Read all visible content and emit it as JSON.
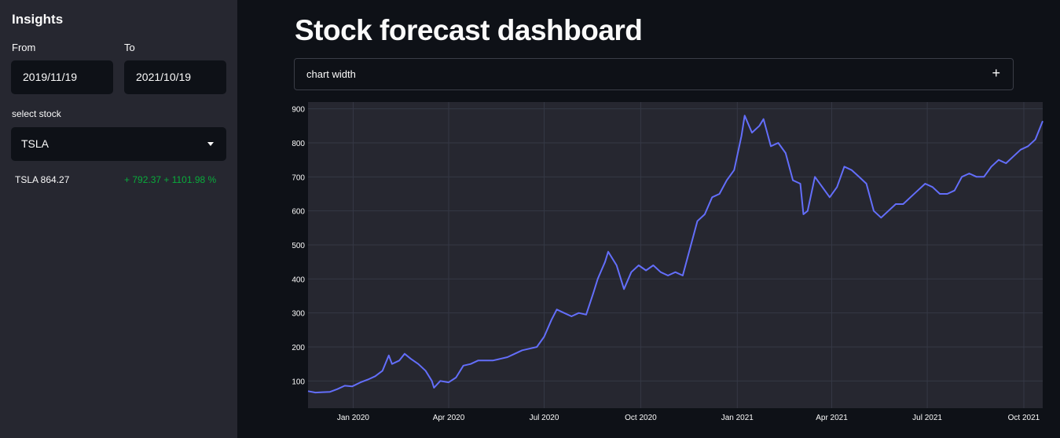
{
  "sidebar": {
    "title": "Insights",
    "from_label": "From",
    "to_label": "To",
    "from_value": "2019/11/19",
    "to_value": "2021/10/19",
    "select_label": "select stock",
    "selected_stock": "TSLA",
    "metric_value": "TSLA 864.27",
    "metric_delta": "+ 792.37 + 1101.98 %",
    "delta_color": "#09ab3b"
  },
  "main": {
    "title": "Stock forecast dashboard",
    "expander_label": "chart width",
    "expander_icon": "plus-icon"
  },
  "chart_data": {
    "type": "line",
    "title": "",
    "xlabel": "",
    "ylabel": "",
    "ylim": [
      20,
      920
    ],
    "xlim": [
      "2019-11-19",
      "2021-10-19"
    ],
    "yticks": [
      100,
      200,
      300,
      400,
      500,
      600,
      700,
      800,
      900
    ],
    "xticks": [
      "2020-01-01",
      "2020-04-01",
      "2020-07-01",
      "2020-10-01",
      "2021-01-01",
      "2021-04-01",
      "2021-07-01",
      "2021-10-01"
    ],
    "xtick_labels": [
      "Jan 2020",
      "Apr 2020",
      "Jul 2020",
      "Oct 2020",
      "Jan 2021",
      "Apr 2021",
      "Jul 2021",
      "Oct 2021"
    ],
    "grid": true,
    "line_color": "#636efa",
    "series": [
      {
        "x": [
          "2019-11-19",
          "2019-11-26",
          "2019-12-03",
          "2019-12-10",
          "2019-12-17",
          "2019-12-24",
          "2019-12-31",
          "2020-01-08",
          "2020-01-15",
          "2020-01-22",
          "2020-01-29",
          "2020-02-04",
          "2020-02-07",
          "2020-02-14",
          "2020-02-19",
          "2020-02-25",
          "2020-03-03",
          "2020-03-10",
          "2020-03-16",
          "2020-03-18",
          "2020-03-24",
          "2020-04-01",
          "2020-04-08",
          "2020-04-15",
          "2020-04-22",
          "2020-04-29",
          "2020-05-06",
          "2020-05-13",
          "2020-05-20",
          "2020-05-27",
          "2020-06-03",
          "2020-06-10",
          "2020-06-17",
          "2020-06-24",
          "2020-07-01",
          "2020-07-08",
          "2020-07-13",
          "2020-07-20",
          "2020-07-27",
          "2020-08-03",
          "2020-08-10",
          "2020-08-17",
          "2020-08-21",
          "2020-08-28",
          "2020-08-31",
          "2020-09-08",
          "2020-09-15",
          "2020-09-22",
          "2020-09-29",
          "2020-10-06",
          "2020-10-13",
          "2020-10-20",
          "2020-10-27",
          "2020-11-03",
          "2020-11-10",
          "2020-11-17",
          "2020-11-24",
          "2020-12-01",
          "2020-12-08",
          "2020-12-15",
          "2020-12-22",
          "2020-12-29",
          "2021-01-05",
          "2021-01-08",
          "2021-01-15",
          "2021-01-22",
          "2021-01-26",
          "2021-02-02",
          "2021-02-09",
          "2021-02-16",
          "2021-02-23",
          "2021-03-02",
          "2021-03-05",
          "2021-03-09",
          "2021-03-16",
          "2021-03-23",
          "2021-03-30",
          "2021-04-06",
          "2021-04-13",
          "2021-04-20",
          "2021-04-27",
          "2021-05-04",
          "2021-05-11",
          "2021-05-18",
          "2021-05-25",
          "2021-06-01",
          "2021-06-08",
          "2021-06-15",
          "2021-06-22",
          "2021-06-29",
          "2021-07-06",
          "2021-07-13",
          "2021-07-20",
          "2021-07-27",
          "2021-08-03",
          "2021-08-10",
          "2021-08-17",
          "2021-08-24",
          "2021-08-31",
          "2021-09-07",
          "2021-09-14",
          "2021-09-21",
          "2021-09-28",
          "2021-10-05",
          "2021-10-12",
          "2021-10-19"
        ],
        "y": [
          70,
          66,
          67,
          68,
          76,
          86,
          84,
          96,
          104,
          114,
          130,
          175,
          150,
          160,
          180,
          165,
          150,
          130,
          100,
          80,
          100,
          96,
          110,
          145,
          150,
          160,
          160,
          160,
          165,
          170,
          180,
          190,
          195,
          200,
          230,
          280,
          310,
          300,
          290,
          300,
          295,
          360,
          400,
          450,
          480,
          440,
          370,
          420,
          440,
          425,
          440,
          420,
          410,
          420,
          410,
          490,
          570,
          590,
          640,
          650,
          690,
          720,
          820,
          880,
          830,
          850,
          870,
          790,
          800,
          770,
          690,
          680,
          590,
          600,
          700,
          670,
          640,
          670,
          730,
          720,
          700,
          680,
          600,
          580,
          600,
          620,
          620,
          640,
          660,
          680,
          670,
          650,
          650,
          660,
          700,
          710,
          700,
          700,
          730,
          750,
          740,
          760,
          780,
          790,
          810,
          864
        ]
      }
    ]
  }
}
